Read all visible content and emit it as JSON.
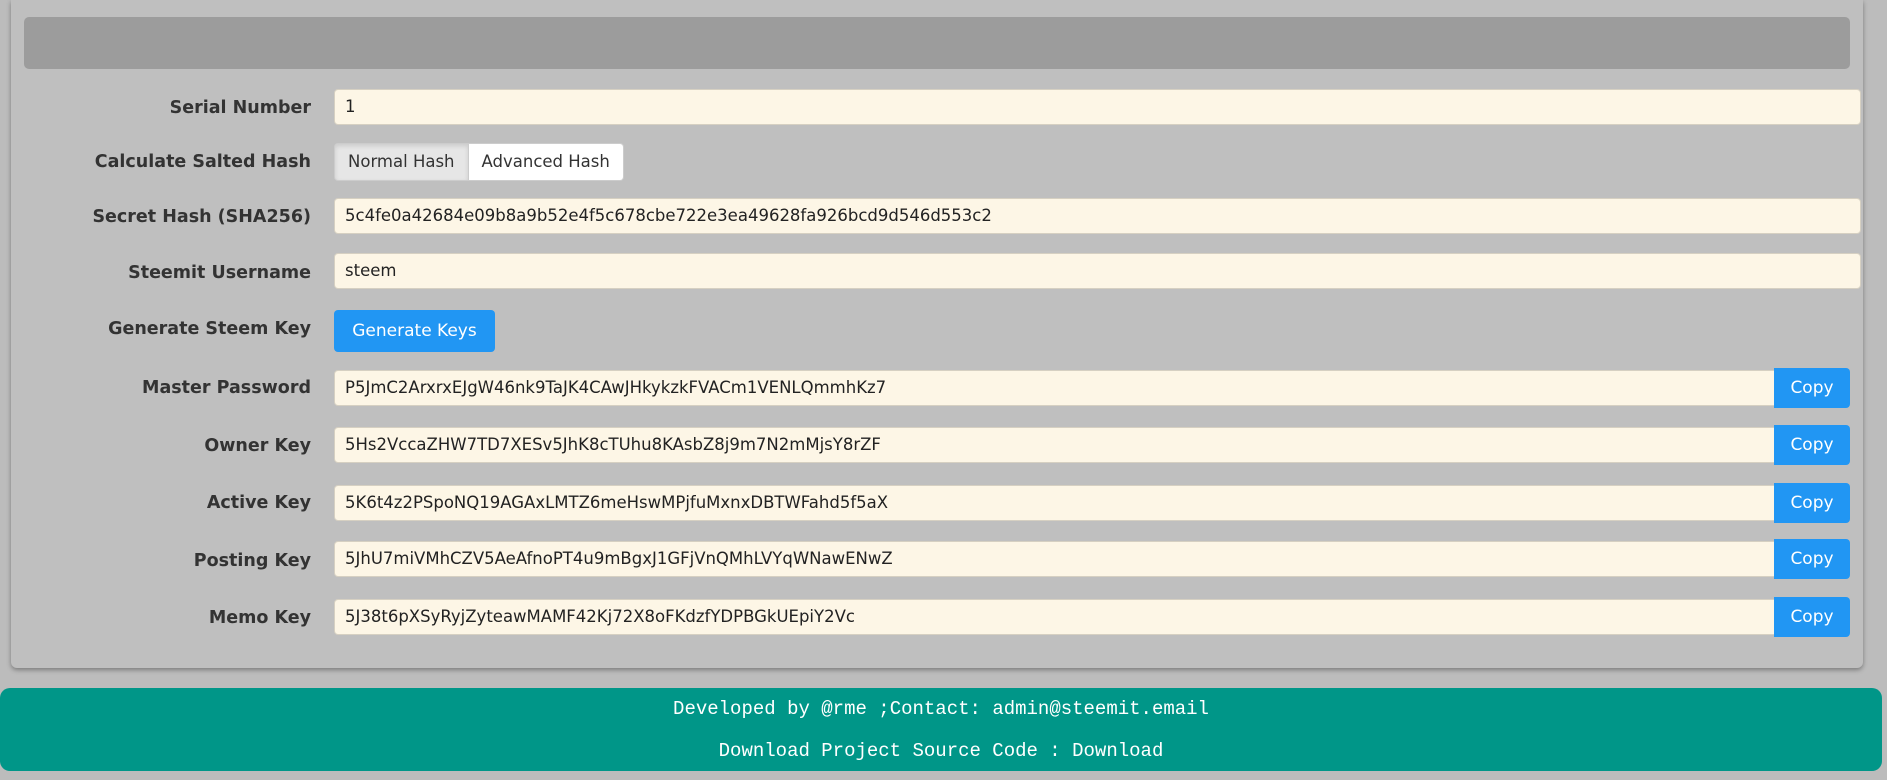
{
  "form": {
    "serial_number": {
      "label": "Serial Number",
      "value": "1"
    },
    "salted_hash": {
      "label": "Calculate Salted Hash",
      "options": [
        "Normal Hash",
        "Advanced Hash"
      ],
      "selected": "Normal Hash"
    },
    "secret_hash": {
      "label": "Secret Hash (SHA256)",
      "value": "5c4fe0a42684e09b8a9b52e4f5c678cbe722e3ea49628fa926bcd9d546d553c2"
    },
    "username": {
      "label": "Steemit Username",
      "value": "steem"
    },
    "generate": {
      "label": "Generate Steem Key",
      "button": "Generate Keys"
    },
    "keys": [
      {
        "label": "Master Password",
        "value": "P5JmC2ArxrxEJgW46nk9TaJK4CAwJHkykzkFVACm1VENLQmmhKz7",
        "copy": "Copy"
      },
      {
        "label": "Owner Key",
        "value": "5Hs2VccaZHW7TD7XESv5JhK8cTUhu8KAsbZ8j9m7N2mMjsY8rZF",
        "copy": "Copy"
      },
      {
        "label": "Active Key",
        "value": "5K6t4z2PSpoNQ19AGAxLMTZ6meHswMPjfuMxnxDBTWFahd5f5aX",
        "copy": "Copy"
      },
      {
        "label": "Posting Key",
        "value": "5JhU7miVMhCZV5AeAfnoPT4u9mBgxJ1GFjVnQMhLVYqWNawENwZ",
        "copy": "Copy"
      },
      {
        "label": "Memo Key",
        "value": "5J38t6pXSyRyjZyteawMAMF42Kj72X8oFKdzfYDPBGkUEpiY2Vc",
        "copy": "Copy"
      }
    ]
  },
  "footer": {
    "developed_prefix": "Developed by ",
    "developer": "@rme",
    "contact_prefix": " ;Contact: ",
    "email": "admin@steemit.email",
    "download_prefix": "Download Project Source Code : ",
    "download_link": "Download"
  },
  "colors": {
    "background": "#bcbcbc",
    "header_bar": "#9c9c9c",
    "input_bg": "#fdf6e6",
    "primary": "#2196f3",
    "footer": "#009688"
  }
}
